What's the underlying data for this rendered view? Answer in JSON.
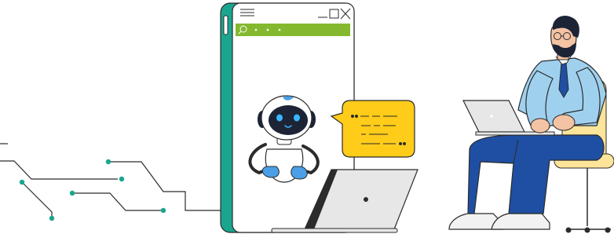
{
  "colors": {
    "line": "#2b2b2b",
    "teal": "#1aa68e",
    "teal_dark": "#0f8a76",
    "search_bar": "#84b92f",
    "bubble": "#ffcc1a",
    "robot_blue": "#4a9fe6",
    "robot_face": "#1c2436",
    "robot_eye": "#39b6ff",
    "shirt": "#9fd1ef",
    "pants": "#1f4fa3",
    "chair_seat": "#fce49a",
    "laptop_grey": "#e7e7e7"
  },
  "icons": {
    "window_menu": "hamburger-icon",
    "window_minimize": "minimize-icon",
    "window_maximize": "maximize-icon",
    "window_close": "close-icon",
    "search": "search-icon",
    "quote_open": "quote-open-icon",
    "quote_close": "quote-close-icon"
  }
}
